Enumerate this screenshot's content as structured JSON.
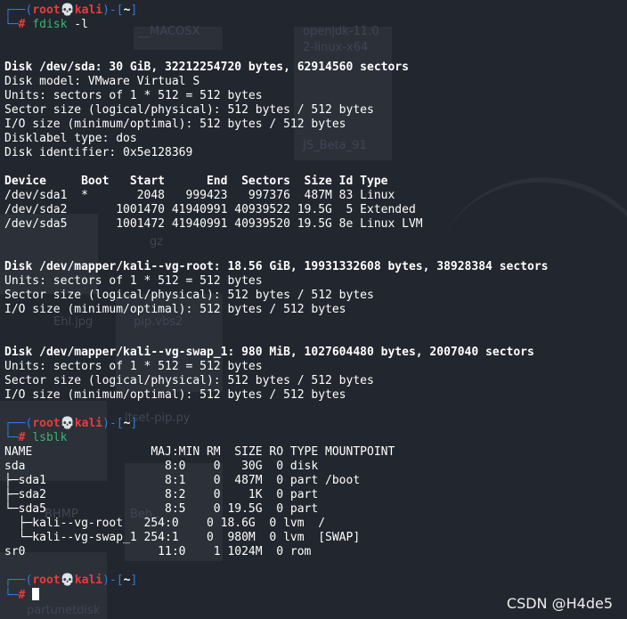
{
  "prompt": {
    "user": "root",
    "host": "kali",
    "separator_glyph": "💀",
    "path": "~",
    "top_prefix": "┌──(",
    "top_suffix_open": ")-[",
    "top_suffix_close": "]",
    "bottom_prefix": "└─"
  },
  "commands": [
    {
      "symbol": "#",
      "command": "fdisk",
      "args": "-l"
    },
    {
      "symbol": "#",
      "command": "lsblk",
      "args": ""
    },
    {
      "symbol": "#",
      "command": "",
      "args": ""
    }
  ],
  "fdisk": {
    "sda_header": "Disk /dev/sda: 30 GiB, 32212254720 bytes, 62914560 sectors",
    "sda_info": [
      "Disk model: VMware Virtual S",
      "Units: sectors of 1 * 512 = 512 bytes",
      "Sector size (logical/physical): 512 bytes / 512 bytes",
      "I/O size (minimum/optimal): 512 bytes / 512 bytes",
      "Disklabel type: dos",
      "Disk identifier: 0x5e128369"
    ],
    "partition_header": "Device     Boot   Start      End  Sectors  Size Id Type",
    "partitions": [
      "/dev/sda1  *       2048   999423   997376  487M 83 Linux",
      "/dev/sda2       1001470 41940991 40939522 19.5G  5 Extended",
      "/dev/sda5       1001472 41940991 40939520 19.5G 8e Linux LVM"
    ],
    "root_header": "Disk /dev/mapper/kali--vg-root: 18.56 GiB, 19931332608 bytes, 38928384 sectors",
    "root_info": [
      "Units: sectors of 1 * 512 = 512 bytes",
      "Sector size (logical/physical): 512 bytes / 512 bytes",
      "I/O size (minimum/optimal): 512 bytes / 512 bytes"
    ],
    "swap_header": "Disk /dev/mapper/kali--vg-swap_1: 980 MiB, 1027604480 bytes, 2007040 sectors",
    "swap_info": [
      "Units: sectors of 1 * 512 = 512 bytes",
      "Sector size (logical/physical): 512 bytes / 512 bytes",
      "I/O size (minimum/optimal): 512 bytes / 512 bytes"
    ]
  },
  "lsblk": {
    "header": "NAME                 MAJ:MIN RM  SIZE RO TYPE MOUNTPOINT",
    "rows": [
      "sda                    8:0    0   30G  0 disk",
      "├─sda1                 8:1    0  487M  0 part /boot",
      "├─sda2                 8:2    0    1K  0 part",
      "└─sda5                 8:5    0 19.5G  0 part",
      "  ├─kali--vg-root   254:0    0 18.6G  0 lvm  /",
      "  └─kali--vg-swap_1 254:1    0  980M  0 lvm  [SWAP]",
      "sr0                   11:0    1 1024M  0 rom"
    ]
  },
  "background_labels": [
    "__MACOSX",
    "openjdk-11.0",
    "2-linux-x64",
    "JS_Beta_91",
    "gz",
    "Ehl.jpg",
    "pip.vbs2",
    "ltset-pip.py",
    "BHMP",
    "Beh..",
    "partunetdisk"
  ],
  "watermark": "CSDN @H4de5",
  "colors": {
    "background": "#22262e",
    "frame": "#2f7dd6",
    "user_host": "#ea3c3c",
    "command": "#3cb371",
    "text": "#ffffff"
  }
}
